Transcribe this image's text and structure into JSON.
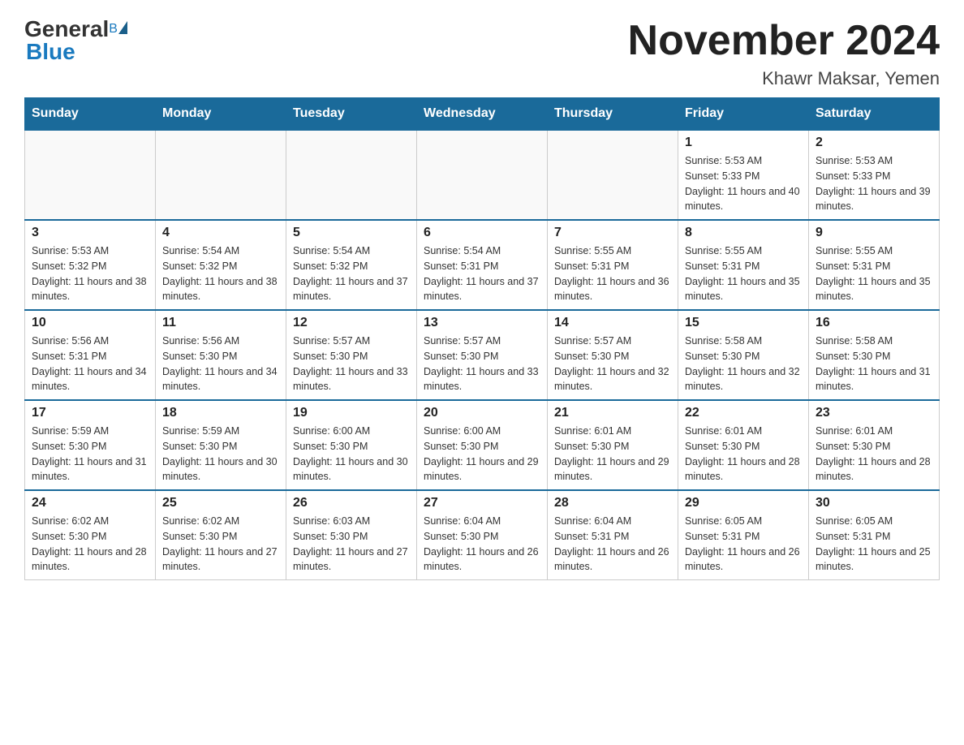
{
  "header": {
    "logo_general": "General",
    "logo_b": "B",
    "logo_blue": "Blue",
    "title": "November 2024",
    "subtitle": "Khawr Maksar, Yemen"
  },
  "calendar": {
    "days_of_week": [
      "Sunday",
      "Monday",
      "Tuesday",
      "Wednesday",
      "Thursday",
      "Friday",
      "Saturday"
    ],
    "weeks": [
      [
        {
          "day": "",
          "info": ""
        },
        {
          "day": "",
          "info": ""
        },
        {
          "day": "",
          "info": ""
        },
        {
          "day": "",
          "info": ""
        },
        {
          "day": "",
          "info": ""
        },
        {
          "day": "1",
          "info": "Sunrise: 5:53 AM\nSunset: 5:33 PM\nDaylight: 11 hours and 40 minutes."
        },
        {
          "day": "2",
          "info": "Sunrise: 5:53 AM\nSunset: 5:33 PM\nDaylight: 11 hours and 39 minutes."
        }
      ],
      [
        {
          "day": "3",
          "info": "Sunrise: 5:53 AM\nSunset: 5:32 PM\nDaylight: 11 hours and 38 minutes."
        },
        {
          "day": "4",
          "info": "Sunrise: 5:54 AM\nSunset: 5:32 PM\nDaylight: 11 hours and 38 minutes."
        },
        {
          "day": "5",
          "info": "Sunrise: 5:54 AM\nSunset: 5:32 PM\nDaylight: 11 hours and 37 minutes."
        },
        {
          "day": "6",
          "info": "Sunrise: 5:54 AM\nSunset: 5:31 PM\nDaylight: 11 hours and 37 minutes."
        },
        {
          "day": "7",
          "info": "Sunrise: 5:55 AM\nSunset: 5:31 PM\nDaylight: 11 hours and 36 minutes."
        },
        {
          "day": "8",
          "info": "Sunrise: 5:55 AM\nSunset: 5:31 PM\nDaylight: 11 hours and 35 minutes."
        },
        {
          "day": "9",
          "info": "Sunrise: 5:55 AM\nSunset: 5:31 PM\nDaylight: 11 hours and 35 minutes."
        }
      ],
      [
        {
          "day": "10",
          "info": "Sunrise: 5:56 AM\nSunset: 5:31 PM\nDaylight: 11 hours and 34 minutes."
        },
        {
          "day": "11",
          "info": "Sunrise: 5:56 AM\nSunset: 5:30 PM\nDaylight: 11 hours and 34 minutes."
        },
        {
          "day": "12",
          "info": "Sunrise: 5:57 AM\nSunset: 5:30 PM\nDaylight: 11 hours and 33 minutes."
        },
        {
          "day": "13",
          "info": "Sunrise: 5:57 AM\nSunset: 5:30 PM\nDaylight: 11 hours and 33 minutes."
        },
        {
          "day": "14",
          "info": "Sunrise: 5:57 AM\nSunset: 5:30 PM\nDaylight: 11 hours and 32 minutes."
        },
        {
          "day": "15",
          "info": "Sunrise: 5:58 AM\nSunset: 5:30 PM\nDaylight: 11 hours and 32 minutes."
        },
        {
          "day": "16",
          "info": "Sunrise: 5:58 AM\nSunset: 5:30 PM\nDaylight: 11 hours and 31 minutes."
        }
      ],
      [
        {
          "day": "17",
          "info": "Sunrise: 5:59 AM\nSunset: 5:30 PM\nDaylight: 11 hours and 31 minutes."
        },
        {
          "day": "18",
          "info": "Sunrise: 5:59 AM\nSunset: 5:30 PM\nDaylight: 11 hours and 30 minutes."
        },
        {
          "day": "19",
          "info": "Sunrise: 6:00 AM\nSunset: 5:30 PM\nDaylight: 11 hours and 30 minutes."
        },
        {
          "day": "20",
          "info": "Sunrise: 6:00 AM\nSunset: 5:30 PM\nDaylight: 11 hours and 29 minutes."
        },
        {
          "day": "21",
          "info": "Sunrise: 6:01 AM\nSunset: 5:30 PM\nDaylight: 11 hours and 29 minutes."
        },
        {
          "day": "22",
          "info": "Sunrise: 6:01 AM\nSunset: 5:30 PM\nDaylight: 11 hours and 28 minutes."
        },
        {
          "day": "23",
          "info": "Sunrise: 6:01 AM\nSunset: 5:30 PM\nDaylight: 11 hours and 28 minutes."
        }
      ],
      [
        {
          "day": "24",
          "info": "Sunrise: 6:02 AM\nSunset: 5:30 PM\nDaylight: 11 hours and 28 minutes."
        },
        {
          "day": "25",
          "info": "Sunrise: 6:02 AM\nSunset: 5:30 PM\nDaylight: 11 hours and 27 minutes."
        },
        {
          "day": "26",
          "info": "Sunrise: 6:03 AM\nSunset: 5:30 PM\nDaylight: 11 hours and 27 minutes."
        },
        {
          "day": "27",
          "info": "Sunrise: 6:04 AM\nSunset: 5:30 PM\nDaylight: 11 hours and 26 minutes."
        },
        {
          "day": "28",
          "info": "Sunrise: 6:04 AM\nSunset: 5:31 PM\nDaylight: 11 hours and 26 minutes."
        },
        {
          "day": "29",
          "info": "Sunrise: 6:05 AM\nSunset: 5:31 PM\nDaylight: 11 hours and 26 minutes."
        },
        {
          "day": "30",
          "info": "Sunrise: 6:05 AM\nSunset: 5:31 PM\nDaylight: 11 hours and 25 minutes."
        }
      ]
    ]
  }
}
